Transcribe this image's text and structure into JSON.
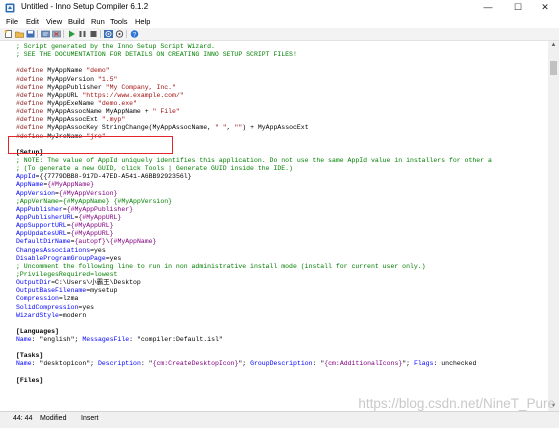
{
  "window": {
    "title": "Untitled - Inno Setup Compiler 6.1.2",
    "controls": {
      "minimize": "—",
      "maximize": "☐",
      "close": "✕"
    }
  },
  "menu": [
    "File",
    "Edit",
    "View",
    "Build",
    "Run",
    "Tools",
    "Help"
  ],
  "toolbar": {
    "icons": [
      "new-file-icon",
      "open-file-icon",
      "save-icon",
      "compile-icon",
      "stop-compile-icon",
      "run-icon",
      "pause-icon",
      "stop-icon",
      "target-icon",
      "help-icon"
    ]
  },
  "code": [
    [
      {
        "t": "comment",
        "v": "; Script generated by the Inno Setup Script Wizard."
      }
    ],
    [
      {
        "t": "comment",
        "v": "; SEE THE DOCUMENTATION FOR DETAILS ON CREATING INNO SETUP SCRIPT FILES!"
      }
    ],
    [],
    [
      {
        "t": "directive",
        "v": "#define"
      },
      {
        "t": "plain",
        "v": " MyAppName "
      },
      {
        "t": "string",
        "v": "\"demo\""
      }
    ],
    [
      {
        "t": "directive",
        "v": "#define"
      },
      {
        "t": "plain",
        "v": " MyAppVersion "
      },
      {
        "t": "string",
        "v": "\"1.5\""
      }
    ],
    [
      {
        "t": "directive",
        "v": "#define"
      },
      {
        "t": "plain",
        "v": " MyAppPublisher "
      },
      {
        "t": "string",
        "v": "\"My Company, Inc.\""
      }
    ],
    [
      {
        "t": "directive",
        "v": "#define"
      },
      {
        "t": "plain",
        "v": " MyAppURL "
      },
      {
        "t": "string",
        "v": "\"https://www.example.com/\""
      }
    ],
    [
      {
        "t": "directive",
        "v": "#define"
      },
      {
        "t": "plain",
        "v": " MyAppExeName "
      },
      {
        "t": "string",
        "v": "\"demo.exe\""
      }
    ],
    [
      {
        "t": "directive",
        "v": "#define"
      },
      {
        "t": "plain",
        "v": " MyAppAssocName MyAppName + "
      },
      {
        "t": "string",
        "v": "\" File\""
      }
    ],
    [
      {
        "t": "directive",
        "v": "#define"
      },
      {
        "t": "plain",
        "v": " MyAppAssocExt "
      },
      {
        "t": "string",
        "v": "\".myp\""
      }
    ],
    [
      {
        "t": "directive",
        "v": "#define"
      },
      {
        "t": "plain",
        "v": " MyAppAssocKey StringChange(MyAppAssocName, "
      },
      {
        "t": "string",
        "v": "\" \""
      },
      {
        "t": "plain",
        "v": ", "
      },
      {
        "t": "string",
        "v": "\"\""
      },
      {
        "t": "plain",
        "v": ") + MyAppAssocExt"
      }
    ],
    [
      {
        "t": "directive",
        "v": "#define"
      },
      {
        "t": "plain",
        "v": " MyJreName "
      },
      {
        "t": "string",
        "v": "\"jre\""
      }
    ],
    [],
    [
      {
        "t": "section",
        "v": "[Setup]"
      }
    ],
    [
      {
        "t": "comment",
        "v": "; NOTE: The value of AppId uniquely identifies this application. Do not use the same AppId value in installers for other a"
      }
    ],
    [
      {
        "t": "comment",
        "v": "; (To generate a new GUID, click Tools | Generate GUID inside the IDE.)"
      }
    ],
    [
      {
        "t": "key",
        "v": "AppId"
      },
      {
        "t": "plain",
        "v": "={{7779DBB8-917D-47ED-A541-A6BB9292356l}"
      }
    ],
    [
      {
        "t": "key",
        "v": "AppName"
      },
      {
        "t": "plain",
        "v": "="
      },
      {
        "t": "const",
        "v": "{#MyAppName}"
      }
    ],
    [
      {
        "t": "key",
        "v": "AppVersion"
      },
      {
        "t": "plain",
        "v": "="
      },
      {
        "t": "const",
        "v": "{#MyAppVersion}"
      }
    ],
    [
      {
        "t": "comment",
        "v": ";AppVerName={#MyAppName} {#MyAppVersion}"
      }
    ],
    [
      {
        "t": "key",
        "v": "AppPublisher"
      },
      {
        "t": "plain",
        "v": "="
      },
      {
        "t": "const",
        "v": "{#MyAppPublisher}"
      }
    ],
    [
      {
        "t": "key",
        "v": "AppPublisherURL"
      },
      {
        "t": "plain",
        "v": "="
      },
      {
        "t": "const",
        "v": "{#MyAppURL}"
      }
    ],
    [
      {
        "t": "key",
        "v": "AppSupportURL"
      },
      {
        "t": "plain",
        "v": "="
      },
      {
        "t": "const",
        "v": "{#MyAppURL}"
      }
    ],
    [
      {
        "t": "key",
        "v": "AppUpdatesURL"
      },
      {
        "t": "plain",
        "v": "="
      },
      {
        "t": "const",
        "v": "{#MyAppURL}"
      }
    ],
    [
      {
        "t": "key",
        "v": "DefaultDirName"
      },
      {
        "t": "plain",
        "v": "="
      },
      {
        "t": "const",
        "v": "{autopf}"
      },
      {
        "t": "plain",
        "v": "\\"
      },
      {
        "t": "const",
        "v": "{#MyAppName}"
      }
    ],
    [
      {
        "t": "key",
        "v": "ChangesAssociations"
      },
      {
        "t": "plain",
        "v": "=yes"
      }
    ],
    [
      {
        "t": "key",
        "v": "DisableProgramGroupPage"
      },
      {
        "t": "plain",
        "v": "=yes"
      }
    ],
    [
      {
        "t": "comment",
        "v": "; Uncomment the following line to run in non administrative install mode (install for current user only.)"
      }
    ],
    [
      {
        "t": "comment",
        "v": ";PrivilegesRequired=lowest"
      }
    ],
    [
      {
        "t": "key",
        "v": "OutputDir"
      },
      {
        "t": "plain",
        "v": "=C:\\Users\\小霸王\\Desktop"
      }
    ],
    [
      {
        "t": "key",
        "v": "OutputBaseFilename"
      },
      {
        "t": "plain",
        "v": "=mysetup"
      }
    ],
    [
      {
        "t": "key",
        "v": "Compression"
      },
      {
        "t": "plain",
        "v": "=lzma"
      }
    ],
    [
      {
        "t": "key",
        "v": "SolidCompression"
      },
      {
        "t": "plain",
        "v": "=yes"
      }
    ],
    [
      {
        "t": "key",
        "v": "WizardStyle"
      },
      {
        "t": "plain",
        "v": "=modern"
      }
    ],
    [],
    [
      {
        "t": "section",
        "v": "[Languages]"
      }
    ],
    [
      {
        "t": "key",
        "v": "Name"
      },
      {
        "t": "plain",
        "v": ": "
      },
      {
        "t": "plain",
        "v": "\"english\""
      },
      {
        "t": "plain",
        "v": "; "
      },
      {
        "t": "key",
        "v": "MessagesFile"
      },
      {
        "t": "plain",
        "v": ": "
      },
      {
        "t": "plain",
        "v": "\"compiler:Default.isl\""
      }
    ],
    [],
    [
      {
        "t": "section",
        "v": "[Tasks]"
      }
    ],
    [
      {
        "t": "key",
        "v": "Name"
      },
      {
        "t": "plain",
        "v": ": "
      },
      {
        "t": "plain",
        "v": "\"desktopicon\""
      },
      {
        "t": "plain",
        "v": "; "
      },
      {
        "t": "key",
        "v": "Description"
      },
      {
        "t": "plain",
        "v": ": \""
      },
      {
        "t": "const",
        "v": "{cm:CreateDesktopIcon}"
      },
      {
        "t": "plain",
        "v": "\"; "
      },
      {
        "t": "key",
        "v": "GroupDescription"
      },
      {
        "t": "plain",
        "v": ": \""
      },
      {
        "t": "const",
        "v": "{cm:AdditionalIcons}"
      },
      {
        "t": "plain",
        "v": "\"; "
      },
      {
        "t": "key",
        "v": "Flags"
      },
      {
        "t": "plain",
        "v": ": unchecked"
      }
    ],
    [],
    [
      {
        "t": "section",
        "v": "[Files]"
      }
    ]
  ],
  "status": {
    "position": "44: 44",
    "state": "Modified",
    "mode": "Insert"
  },
  "watermark": "https://blog.csdn.net/NineT_Pure"
}
